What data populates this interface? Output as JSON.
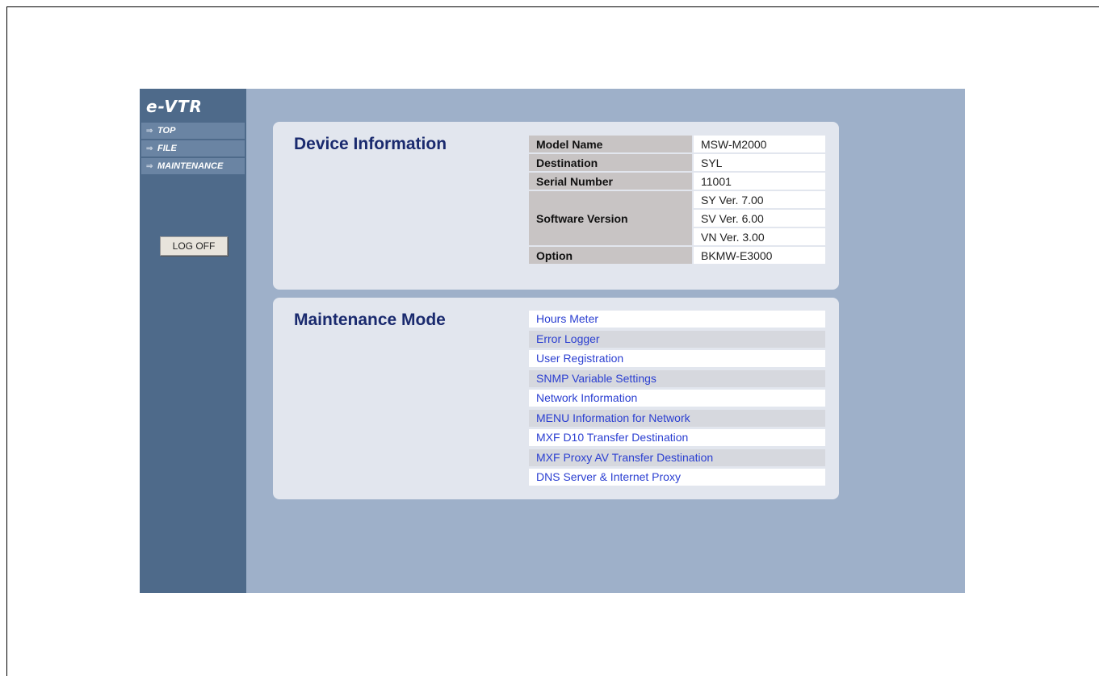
{
  "sidebar": {
    "logo": "e-VTR",
    "nav": [
      {
        "label": "TOP"
      },
      {
        "label": "FILE"
      },
      {
        "label": "MAINTENANCE"
      }
    ],
    "logoff_label": "LOG OFF"
  },
  "device_info": {
    "title": "Device Information",
    "model_name_label": "Model Name",
    "model_name": "MSW-M2000",
    "destination_label": "Destination",
    "destination": "SYL",
    "serial_label": "Serial Number",
    "serial": "11001",
    "software_label": "Software Version",
    "software_versions": [
      "SY Ver. 7.00",
      "SV Ver. 6.00",
      "VN Ver. 3.00"
    ],
    "option_label": "Option",
    "option": "BKMW-E3000"
  },
  "maintenance": {
    "title": "Maintenance Mode",
    "links": [
      "Hours Meter",
      "Error Logger",
      "User Registration",
      "SNMP Variable Settings",
      "Network Information",
      "MENU Information for Network",
      "MXF D10 Transfer Destination",
      "MXF Proxy AV Transfer Destination",
      "DNS Server & Internet Proxy"
    ]
  }
}
